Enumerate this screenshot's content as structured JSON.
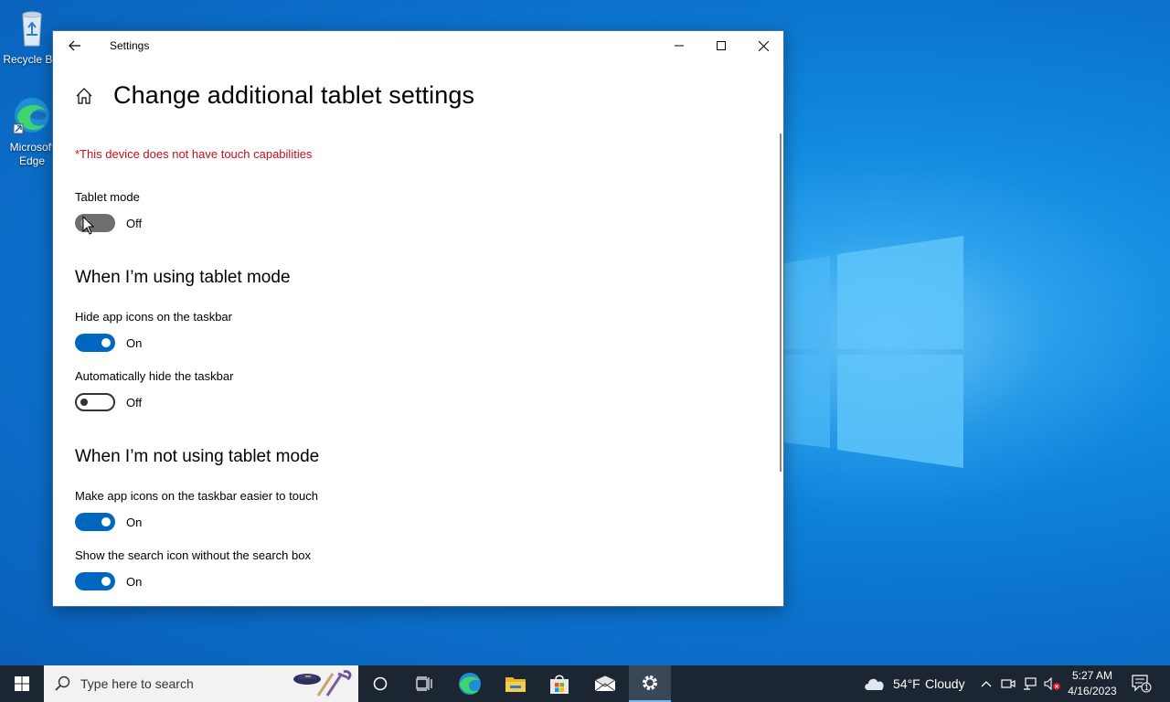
{
  "desktop": {
    "icons": [
      {
        "label": "Recycle Bin",
        "icon": "recycle-bin-icon"
      },
      {
        "label": "Microsoft Edge",
        "icon": "edge-icon"
      }
    ]
  },
  "window": {
    "title": "Settings",
    "page_title": "Change additional tablet settings",
    "warning": "*This device does not have touch capabilities",
    "tablet_mode": {
      "label": "Tablet mode",
      "state": "Off"
    },
    "section_using": {
      "heading": "When I’m using tablet mode",
      "settings": [
        {
          "label": "Hide app icons on the taskbar",
          "state": "On"
        },
        {
          "label": "Automatically hide the taskbar",
          "state": "Off"
        }
      ]
    },
    "section_not_using": {
      "heading": "When I’m not using tablet mode",
      "settings": [
        {
          "label": "Make app icons on the taskbar easier to touch",
          "state": "On"
        },
        {
          "label": "Show the search icon without the search box",
          "state": "On"
        }
      ]
    }
  },
  "taskbar": {
    "search_placeholder": "Type here to search",
    "weather": {
      "temp": "54°F",
      "condition": "Cloudy"
    },
    "time": "5:27 AM",
    "date": "4/16/2023",
    "notification_count": "1"
  },
  "colors": {
    "accent": "#0067c0",
    "warning": "#c50f1f",
    "taskbar": "#1c2632"
  }
}
